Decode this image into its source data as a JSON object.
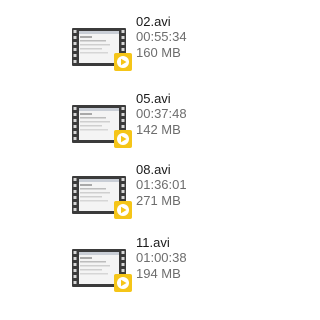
{
  "files": [
    {
      "name": "02.avi",
      "duration": "00:55:34",
      "size": "160 MB",
      "icon": "video-file-icon",
      "badge_color": "#f5c518"
    },
    {
      "name": "05.avi",
      "duration": "00:37:48",
      "size": "142 MB",
      "icon": "video-file-icon",
      "badge_color": "#f5c518"
    },
    {
      "name": "08.avi",
      "duration": "01:36:01",
      "size": "271 MB",
      "icon": "video-file-icon",
      "badge_color": "#f5c518"
    },
    {
      "name": "11.avi",
      "duration": "01:00:38",
      "size": "194 MB",
      "icon": "video-file-icon",
      "badge_color": "#f5c518"
    }
  ]
}
